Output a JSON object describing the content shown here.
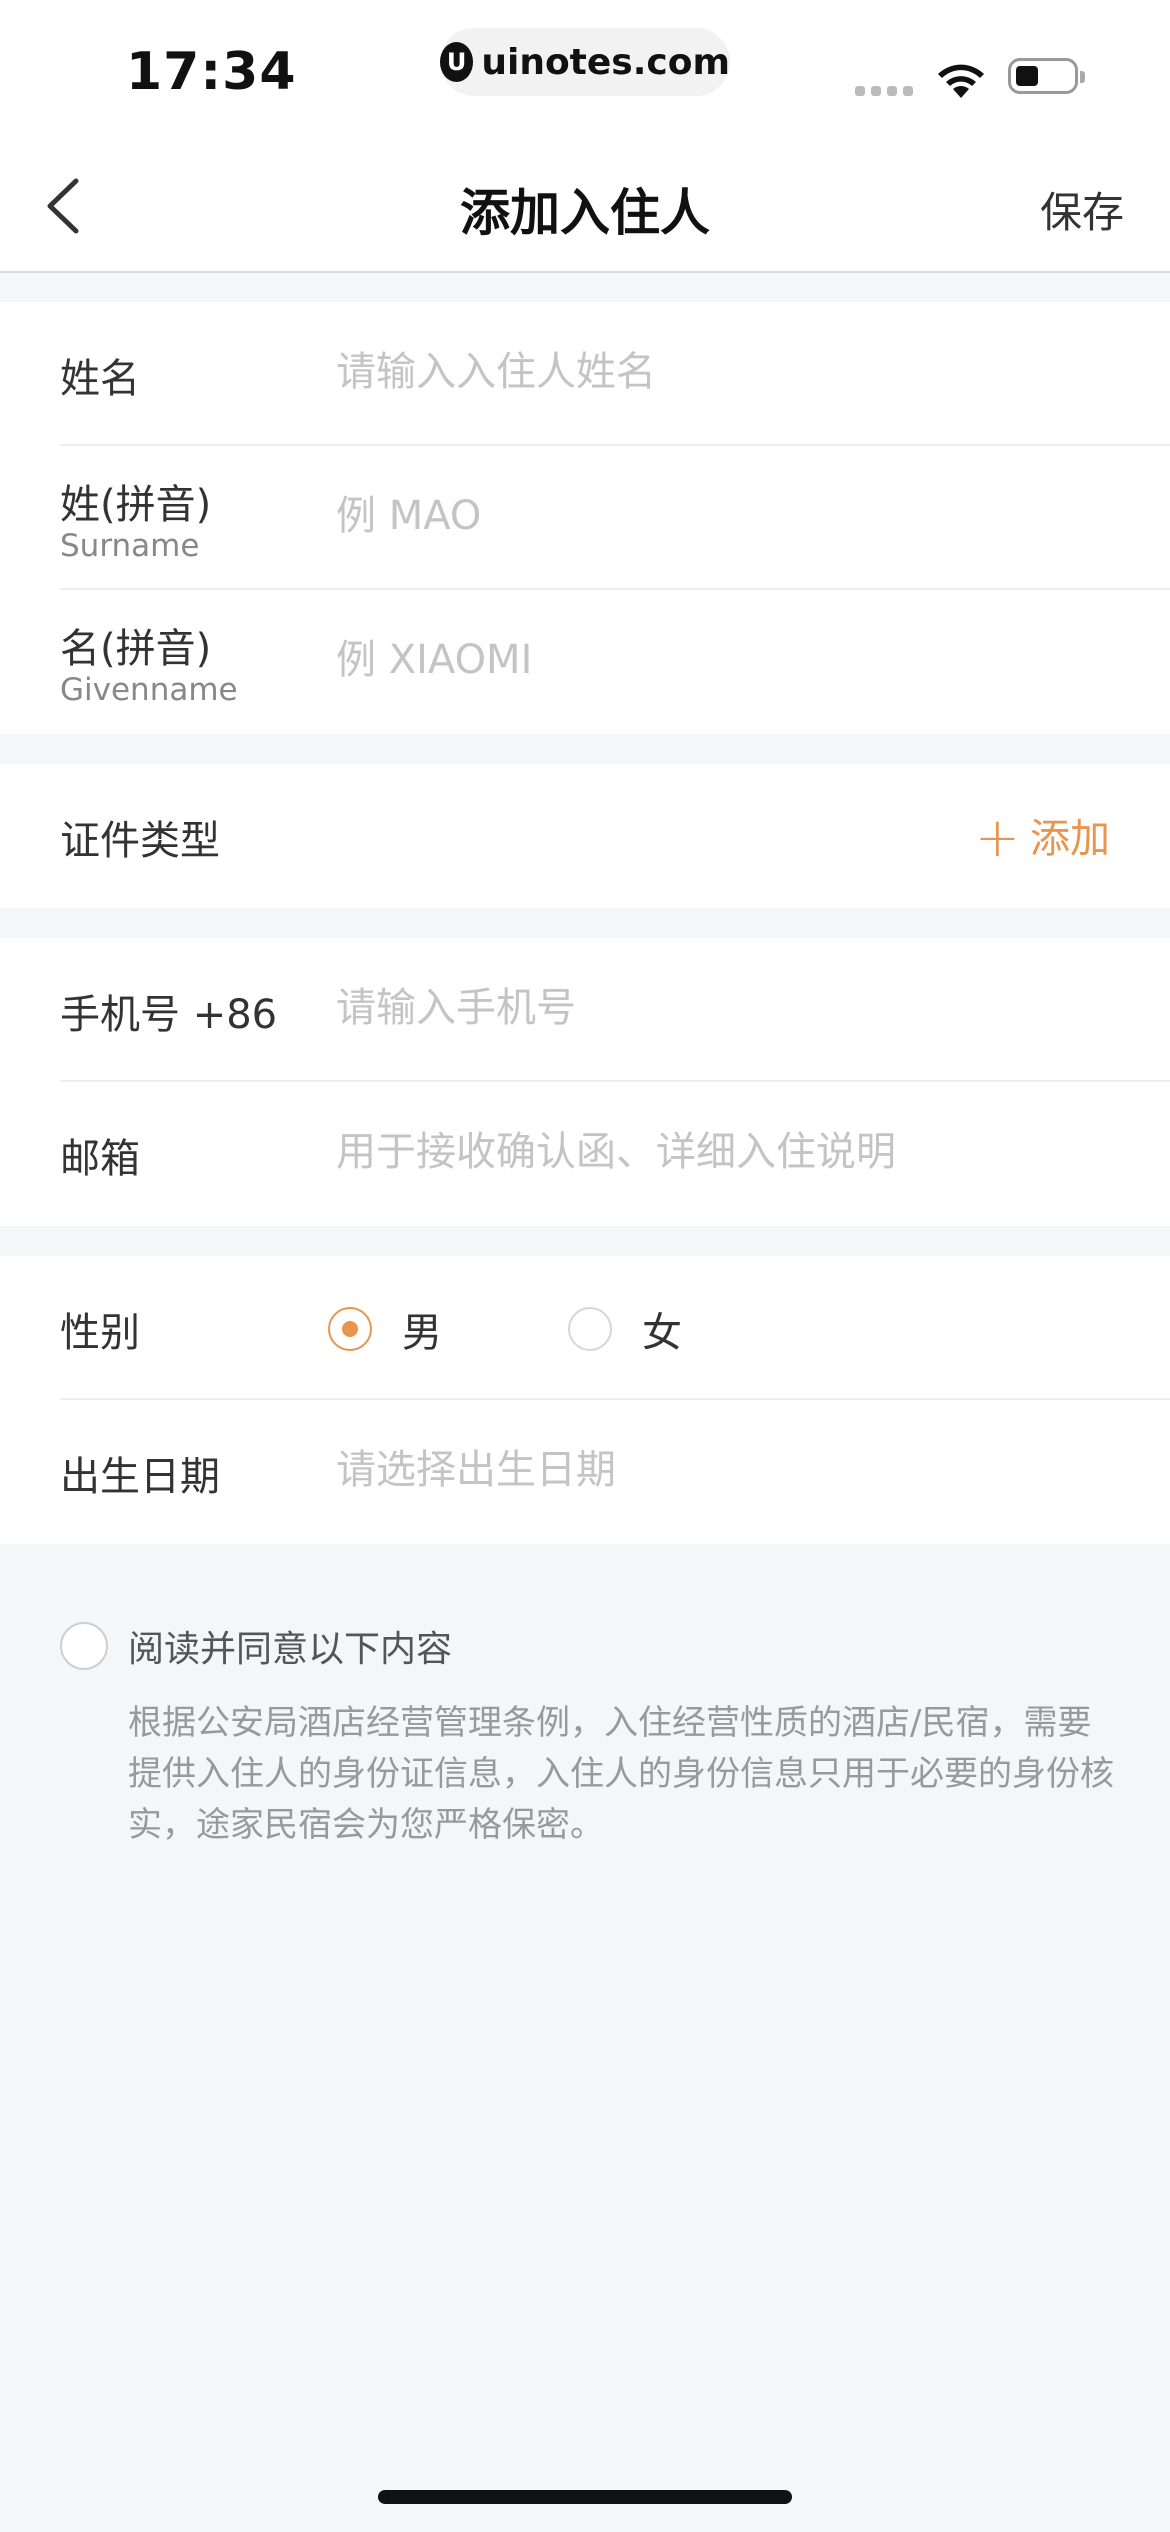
{
  "status_bar": {
    "time": "17:34",
    "watermark": "uinotes.com",
    "watermark_logo": "U"
  },
  "nav": {
    "title": "添加入住人",
    "save_label": "保存"
  },
  "name_section": {
    "name_label": "姓名",
    "name_placeholder": "请输入入住人姓名",
    "surname_label": "姓(拼音)",
    "surname_sub": "Surname",
    "surname_placeholder": "例 MAO",
    "givenname_label": "名(拼音)",
    "givenname_sub": "Givenname",
    "givenname_placeholder": "例 XIAOMI"
  },
  "id_section": {
    "id_type_label": "证件类型",
    "add_label": "添加"
  },
  "contact_section": {
    "phone_label": "手机号 +86",
    "phone_placeholder": "请输入手机号",
    "email_label": "邮箱",
    "email_placeholder": "用于接收确认函、详细入住说明"
  },
  "profile_section": {
    "gender_label": "性别",
    "gender_options": [
      {
        "label": "男",
        "selected": true
      },
      {
        "label": "女",
        "selected": false
      }
    ],
    "birthdate_label": "出生日期",
    "birthdate_placeholder": "请选择出生日期"
  },
  "agreement": {
    "label": "阅读并同意以下内容",
    "checked": false,
    "notice": "根据公安局酒店经营管理条例，入住经营性质的酒店/民宿，需要提供入住人的身份证信息，入住人的身份信息只用于必要的身份核实，途家民宿会为您严格保密。"
  },
  "colors": {
    "accent": "#e8954e",
    "background": "#f5f6f8",
    "placeholder": "#c4c4c4"
  },
  "icons": {
    "back": "chevron-left-icon",
    "add": "plus-icon",
    "wifi": "wifi-icon",
    "battery": "battery-icon",
    "signal": "signal-icon"
  }
}
